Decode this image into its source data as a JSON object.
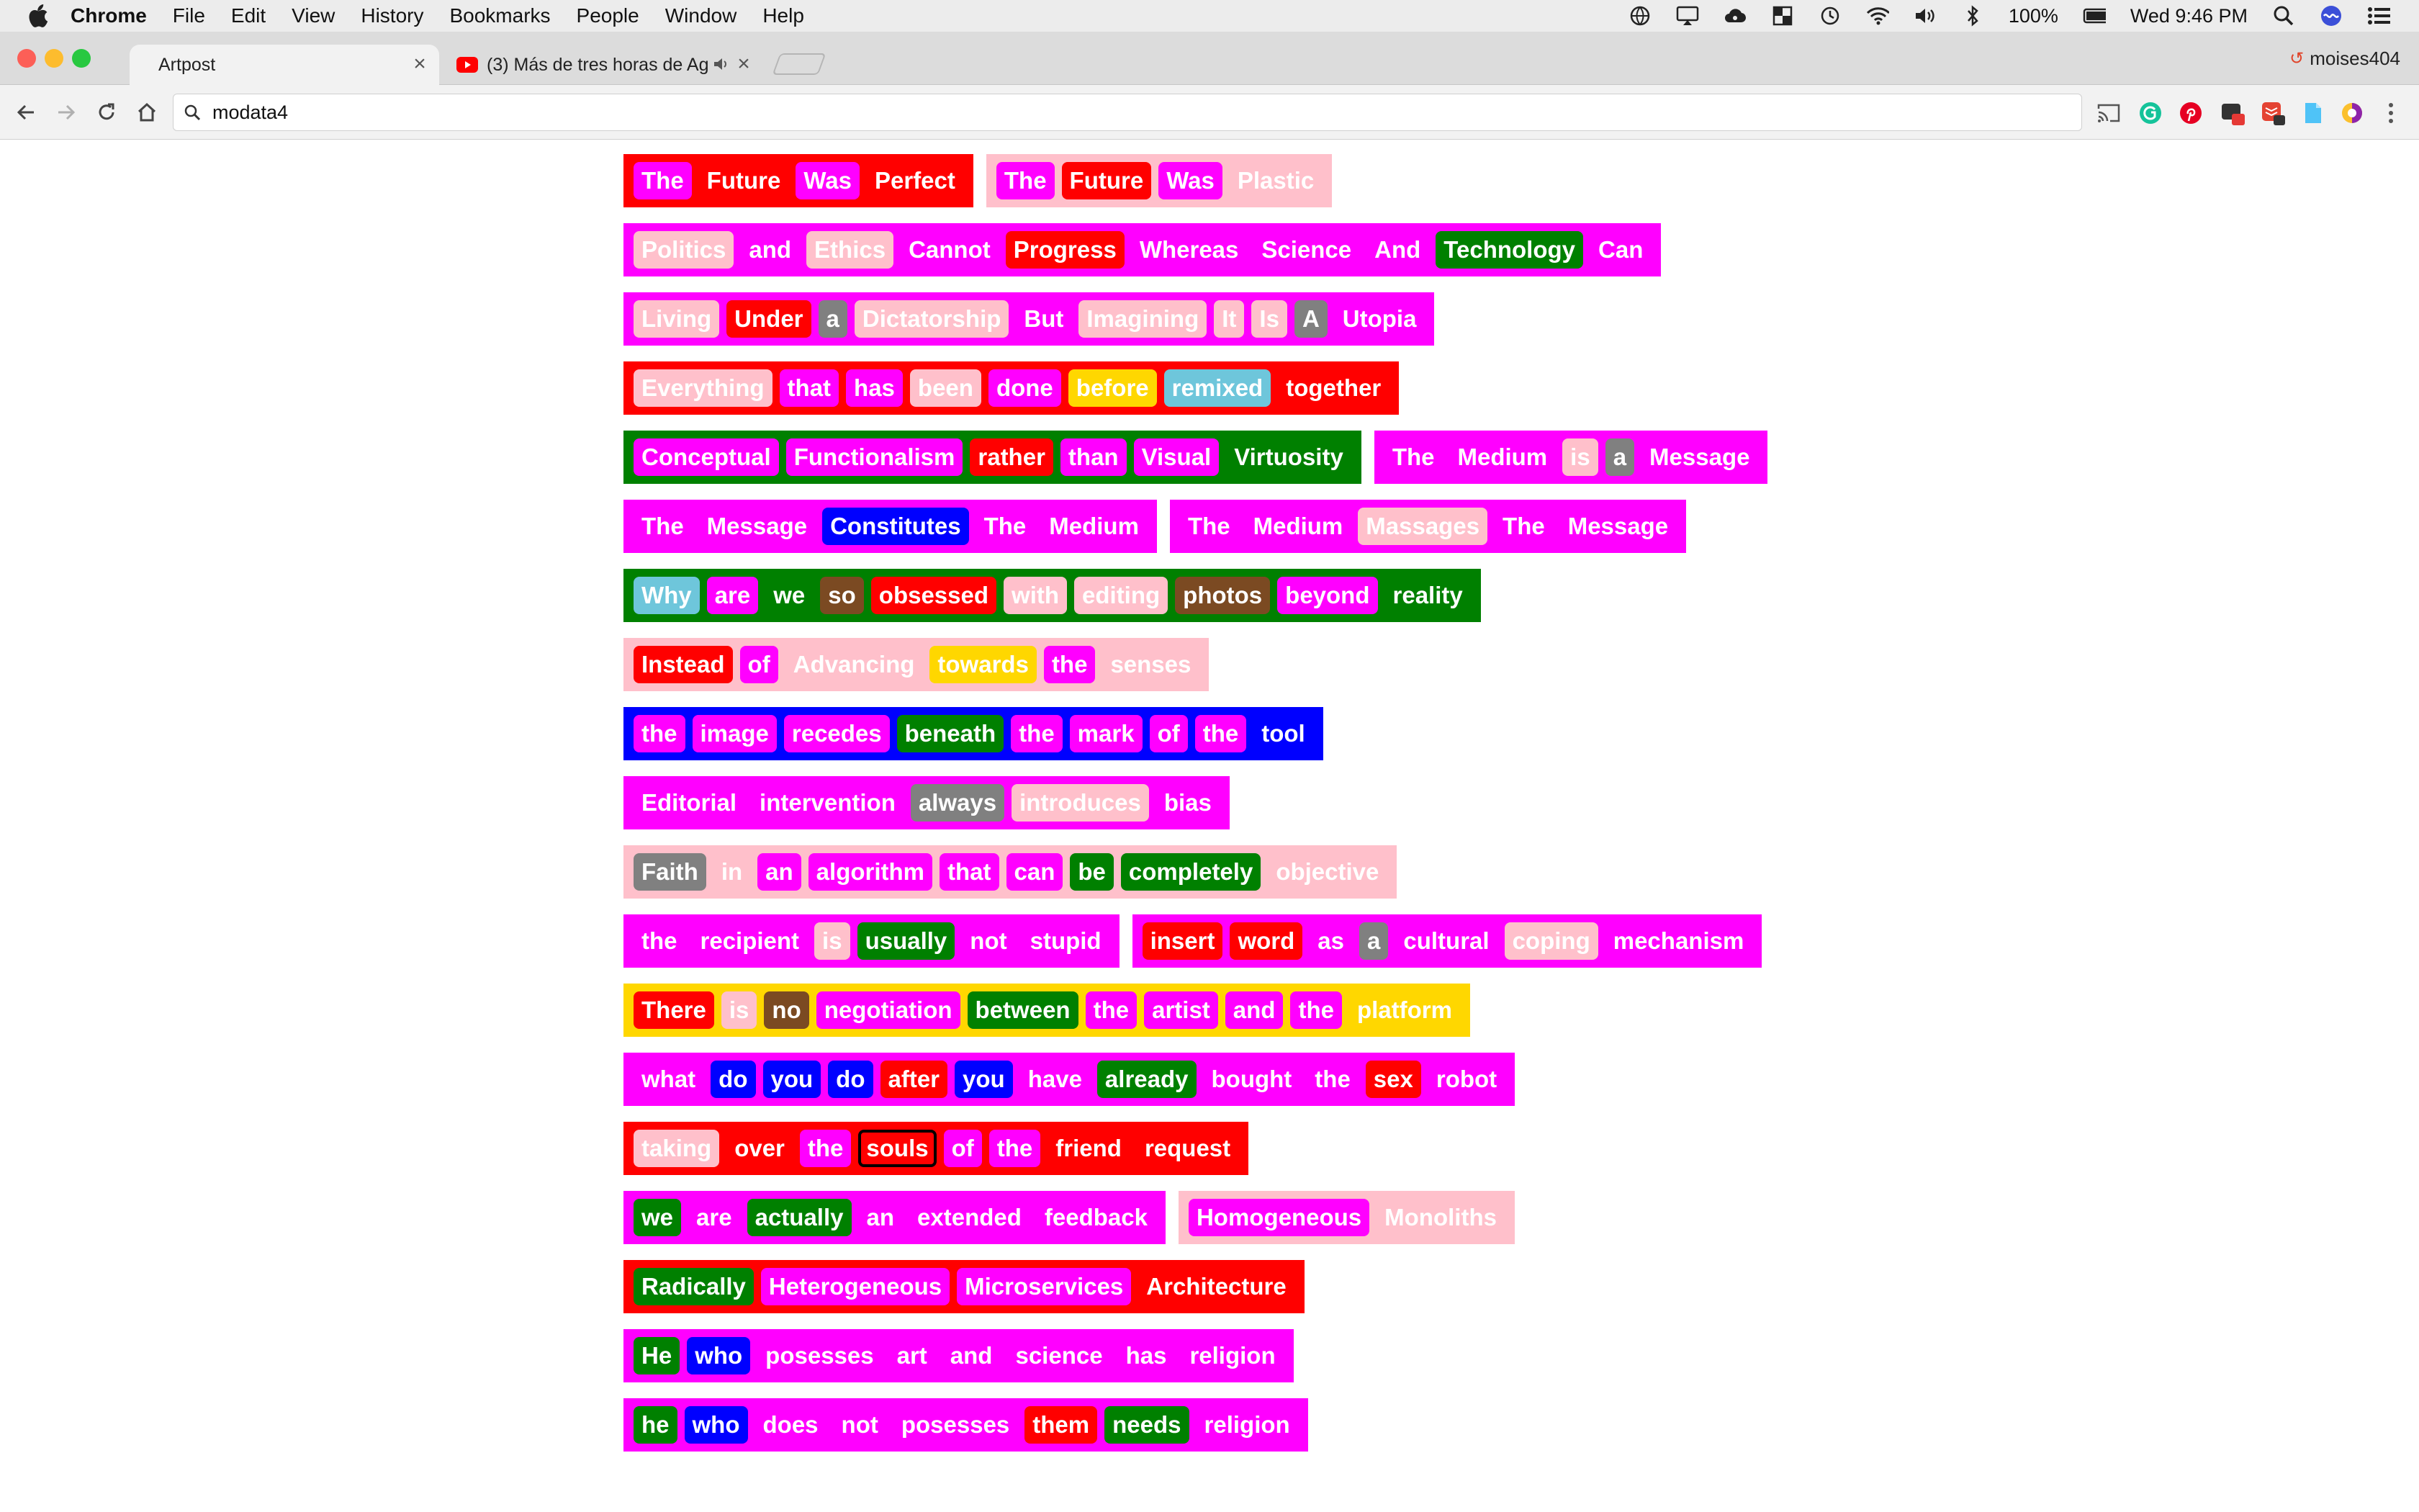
{
  "menubar": {
    "app": "Chrome",
    "items": [
      "File",
      "Edit",
      "View",
      "History",
      "Bookmarks",
      "People",
      "Window",
      "Help"
    ],
    "battery": "100%",
    "clock": "Wed 9:46 PM"
  },
  "tabs": [
    {
      "title": "Artpost",
      "active": true
    },
    {
      "title": "(3) Más de tres horas de Ag",
      "active": false
    }
  ],
  "profile": "moises404",
  "omnibox": {
    "url": "modata4"
  },
  "colors": {
    "magenta": "#ff00ff",
    "red": "#ff0000",
    "green": "#008000",
    "blue": "#0000ff",
    "pink": "#ffc0cb",
    "gray": "#808080",
    "brown": "#7b4a22",
    "gold": "#ffd700",
    "lightblue": "#6ec6db"
  },
  "rows": [
    [
      {
        "bg": "red",
        "words": [
          [
            "The",
            "magenta"
          ],
          [
            "Future",
            "red"
          ],
          [
            "Was",
            "magenta"
          ],
          [
            "Perfect",
            "red"
          ]
        ]
      },
      {
        "bg": "pink",
        "words": [
          [
            "The",
            "magenta"
          ],
          [
            "Future",
            "red"
          ],
          [
            "Was",
            "magenta"
          ],
          [
            "Plastic",
            "pink"
          ]
        ]
      }
    ],
    [
      {
        "bg": "magenta",
        "words": [
          [
            "Politics",
            "pink"
          ],
          [
            "and",
            "magenta"
          ],
          [
            "Ethics",
            "pink"
          ],
          [
            "Cannot",
            "magenta"
          ],
          [
            "Progress",
            "red"
          ],
          [
            "Whereas",
            "magenta"
          ],
          [
            "Science",
            "magenta"
          ],
          [
            "And",
            "magenta"
          ],
          [
            "Technology",
            "green"
          ],
          [
            "Can",
            "magenta"
          ]
        ]
      }
    ],
    [
      {
        "bg": "magenta",
        "words": [
          [
            "Living",
            "pink"
          ],
          [
            "Under",
            "red"
          ],
          [
            "a",
            "gray"
          ],
          [
            "Dictatorship",
            "pink"
          ],
          [
            "But",
            "magenta"
          ],
          [
            "Imagining",
            "pink"
          ],
          [
            "It",
            "pink"
          ],
          [
            "Is",
            "pink"
          ],
          [
            "A",
            "gray"
          ],
          [
            "Utopia",
            "magenta"
          ]
        ]
      }
    ],
    [
      {
        "bg": "red",
        "words": [
          [
            "Everything",
            "pink"
          ],
          [
            "that",
            "magenta"
          ],
          [
            "has",
            "magenta"
          ],
          [
            "been",
            "pink"
          ],
          [
            "done",
            "magenta"
          ],
          [
            "before",
            "gold"
          ],
          [
            "remixed",
            "lightblue"
          ],
          [
            "together",
            "red"
          ]
        ]
      }
    ],
    [
      {
        "bg": "green",
        "words": [
          [
            "Conceptual",
            "magenta"
          ],
          [
            "Functionalism",
            "magenta"
          ],
          [
            "rather",
            "red"
          ],
          [
            "than",
            "magenta"
          ],
          [
            "Visual",
            "magenta"
          ],
          [
            "Virtuosity",
            "green"
          ]
        ]
      },
      {
        "bg": "magenta",
        "words": [
          [
            "The",
            "magenta"
          ],
          [
            "Medium",
            "magenta"
          ],
          [
            "is",
            "pink"
          ],
          [
            "a",
            "gray"
          ],
          [
            "Message",
            "magenta"
          ]
        ]
      }
    ],
    [
      {
        "bg": "magenta",
        "words": [
          [
            "The",
            "magenta"
          ],
          [
            "Message",
            "magenta"
          ],
          [
            "Constitutes",
            "blue"
          ],
          [
            "The",
            "magenta"
          ],
          [
            "Medium",
            "magenta"
          ]
        ]
      },
      {
        "bg": "magenta",
        "words": [
          [
            "The",
            "magenta"
          ],
          [
            "Medium",
            "magenta"
          ],
          [
            "Massages",
            "pink"
          ],
          [
            "The",
            "magenta"
          ],
          [
            "Message",
            "magenta"
          ]
        ]
      }
    ],
    [
      {
        "bg": "green",
        "words": [
          [
            "Why",
            "lightblue"
          ],
          [
            "are",
            "magenta"
          ],
          [
            "we",
            "green"
          ],
          [
            "so",
            "brown"
          ],
          [
            "obsessed",
            "red"
          ],
          [
            "with",
            "pink"
          ],
          [
            "editing",
            "pink"
          ],
          [
            "photos",
            "brown"
          ],
          [
            "beyond",
            "magenta"
          ],
          [
            "reality",
            "green"
          ]
        ]
      }
    ],
    [
      {
        "bg": "pink",
        "words": [
          [
            "Instead",
            "red"
          ],
          [
            "of",
            "magenta"
          ],
          [
            "Advancing",
            "pink"
          ],
          [
            "towards",
            "gold"
          ],
          [
            "the",
            "magenta"
          ],
          [
            "senses",
            "pink"
          ]
        ]
      }
    ],
    [
      {
        "bg": "blue",
        "words": [
          [
            "the",
            "magenta"
          ],
          [
            "image",
            "magenta"
          ],
          [
            "recedes",
            "magenta"
          ],
          [
            "beneath",
            "green"
          ],
          [
            "the",
            "magenta"
          ],
          [
            "mark",
            "magenta"
          ],
          [
            "of",
            "magenta"
          ],
          [
            "the",
            "magenta"
          ],
          [
            "tool",
            "blue"
          ]
        ]
      }
    ],
    [
      {
        "bg": "magenta",
        "words": [
          [
            "Editorial",
            "magenta"
          ],
          [
            "intervention",
            "magenta"
          ],
          [
            "always",
            "gray"
          ],
          [
            "introduces",
            "pink"
          ],
          [
            "bias",
            "magenta"
          ]
        ]
      }
    ],
    [
      {
        "bg": "pink",
        "words": [
          [
            "Faith",
            "gray"
          ],
          [
            "in",
            "pink"
          ],
          [
            "an",
            "magenta"
          ],
          [
            "algorithm",
            "magenta"
          ],
          [
            "that",
            "magenta"
          ],
          [
            "can",
            "magenta"
          ],
          [
            "be",
            "green"
          ],
          [
            "completely",
            "green"
          ],
          [
            "objective",
            "pink"
          ]
        ]
      }
    ],
    [
      {
        "bg": "magenta",
        "words": [
          [
            "the",
            "magenta"
          ],
          [
            "recipient",
            "magenta"
          ],
          [
            "is",
            "pink"
          ],
          [
            "usually",
            "green"
          ],
          [
            "not",
            "magenta"
          ],
          [
            "stupid",
            "magenta"
          ]
        ]
      },
      {
        "bg": "magenta",
        "words": [
          [
            "insert",
            "red"
          ],
          [
            "word",
            "red"
          ],
          [
            "as",
            "magenta"
          ],
          [
            "a",
            "gray"
          ],
          [
            "cultural",
            "magenta"
          ],
          [
            "coping",
            "pink"
          ],
          [
            "mechanism",
            "magenta"
          ]
        ]
      }
    ],
    [
      {
        "bg": "gold",
        "words": [
          [
            "There",
            "red"
          ],
          [
            "is",
            "pink"
          ],
          [
            "no",
            "brown"
          ],
          [
            "negotiation",
            "magenta"
          ],
          [
            "between",
            "green"
          ],
          [
            "the",
            "magenta"
          ],
          [
            "artist",
            "magenta"
          ],
          [
            "and",
            "magenta"
          ],
          [
            "the",
            "magenta"
          ],
          [
            "platform",
            "gold"
          ]
        ]
      }
    ],
    [
      {
        "bg": "magenta",
        "words": [
          [
            "what",
            "magenta"
          ],
          [
            "do",
            "blue"
          ],
          [
            "you",
            "blue"
          ],
          [
            "do",
            "blue"
          ],
          [
            "after",
            "red"
          ],
          [
            "you",
            "blue"
          ],
          [
            "have",
            "magenta"
          ],
          [
            "already",
            "green"
          ],
          [
            "bought",
            "magenta"
          ],
          [
            "the",
            "magenta"
          ],
          [
            "sex",
            "red"
          ],
          [
            "robot",
            "magenta"
          ]
        ]
      }
    ],
    [
      {
        "bg": "red",
        "words": [
          [
            "taking",
            "pink"
          ],
          [
            "over",
            "red"
          ],
          [
            "the",
            "magenta"
          ],
          [
            "souls",
            "red",
            "outlined"
          ],
          [
            "of",
            "magenta"
          ],
          [
            "the",
            "magenta"
          ],
          [
            "friend",
            "red"
          ],
          [
            "request",
            "red"
          ]
        ]
      }
    ],
    [
      {
        "bg": "magenta",
        "words": [
          [
            "we",
            "green"
          ],
          [
            "are",
            "magenta"
          ],
          [
            "actually",
            "green"
          ],
          [
            "an",
            "magenta"
          ],
          [
            "extended",
            "magenta"
          ],
          [
            "feedback",
            "magenta"
          ]
        ]
      },
      {
        "bg": "pink",
        "words": [
          [
            "Homogeneous",
            "magenta"
          ],
          [
            "Monoliths",
            "pink"
          ]
        ]
      }
    ],
    [
      {
        "bg": "red",
        "words": [
          [
            "Radically",
            "green"
          ],
          [
            "Heterogeneous",
            "magenta"
          ],
          [
            "Microservices",
            "magenta"
          ],
          [
            "Architecture",
            "red"
          ]
        ]
      }
    ],
    [
      {
        "bg": "magenta",
        "words": [
          [
            "He",
            "green"
          ],
          [
            "who",
            "blue"
          ],
          [
            "posesses",
            "magenta"
          ],
          [
            "art",
            "magenta"
          ],
          [
            "and",
            "magenta"
          ],
          [
            "science",
            "magenta"
          ],
          [
            "has",
            "magenta"
          ],
          [
            "religion",
            "magenta"
          ]
        ]
      }
    ],
    [
      {
        "bg": "magenta",
        "words": [
          [
            "he",
            "green"
          ],
          [
            "who",
            "blue"
          ],
          [
            "does",
            "magenta"
          ],
          [
            "not",
            "magenta"
          ],
          [
            "posesses",
            "magenta"
          ],
          [
            "them",
            "red"
          ],
          [
            "needs",
            "green"
          ],
          [
            "religion",
            "magenta"
          ]
        ]
      }
    ]
  ]
}
